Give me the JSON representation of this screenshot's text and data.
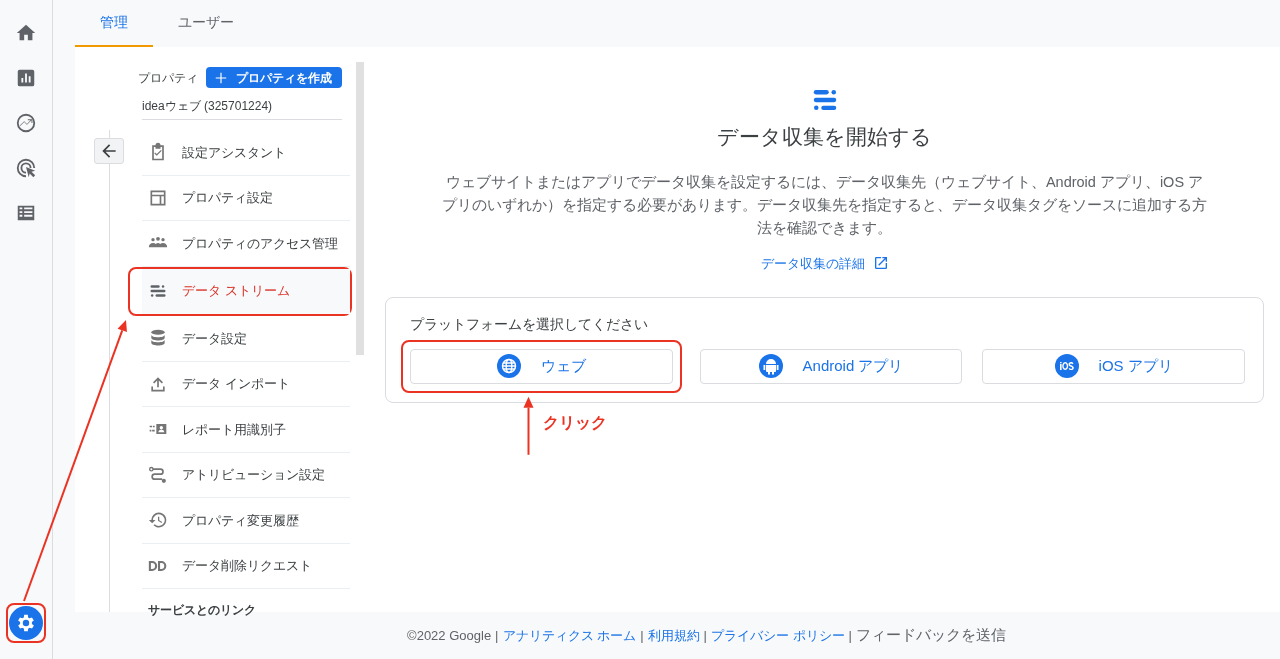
{
  "rail": {
    "settings": {
      "selected": true,
      "highlighted": true
    }
  },
  "tabs": [
    {
      "label": "管理",
      "selected": true
    },
    {
      "label": "ユーザー",
      "selected": false
    }
  ],
  "property": {
    "label": "プロパティ",
    "create_button": "プロパティを作成",
    "name": "ideaウェブ (325701224)"
  },
  "nav": {
    "items": [
      {
        "label": "設定アシスタント",
        "selected": false,
        "highlighted": false
      },
      {
        "label": "プロパティ設定",
        "selected": false,
        "highlighted": false
      },
      {
        "label": "プロパティのアクセス管理",
        "selected": false,
        "highlighted": false
      },
      {
        "label": "データ ストリーム",
        "selected": true,
        "highlighted": true
      },
      {
        "label": "データ設定",
        "selected": false,
        "highlighted": false
      },
      {
        "label": "データ インポート",
        "selected": false,
        "highlighted": false
      },
      {
        "label": "レポート用識別子",
        "selected": false,
        "highlighted": false
      },
      {
        "label": "アトリビューション設定",
        "selected": false,
        "highlighted": false
      },
      {
        "label": "プロパティ変更履歴",
        "selected": false,
        "highlighted": false
      },
      {
        "label": "データ削除リクエスト",
        "selected": false,
        "highlighted": false
      }
    ],
    "section_heading": "サービスとのリンク"
  },
  "main": {
    "title": "データ収集を開始する",
    "description": "ウェブサイトまたはアプリでデータ収集を設定するには、データ収集先（ウェブサイト、Android アプリ、iOS アプリのいずれか）を指定する必要があります。データ収集先を指定すると、データ収集タグをソースに追加する方法を確認できます。",
    "link": "データ収集の詳細",
    "card": {
      "heading": "プラットフォームを選択してください",
      "platforms": [
        {
          "label": "ウェブ",
          "highlighted": true
        },
        {
          "label": "Android アプリ",
          "highlighted": false
        },
        {
          "label": "iOS アプリ",
          "highlighted": false
        }
      ]
    },
    "annotation": "クリック"
  },
  "footer": {
    "copyright": "©2022 Google",
    "separators": [
      "|",
      "|",
      "|",
      "|"
    ],
    "links": [
      "アナリティクス ホーム",
      "利用規約",
      "プライバシー ポリシー"
    ],
    "feedback": "フィードバックを送信"
  }
}
